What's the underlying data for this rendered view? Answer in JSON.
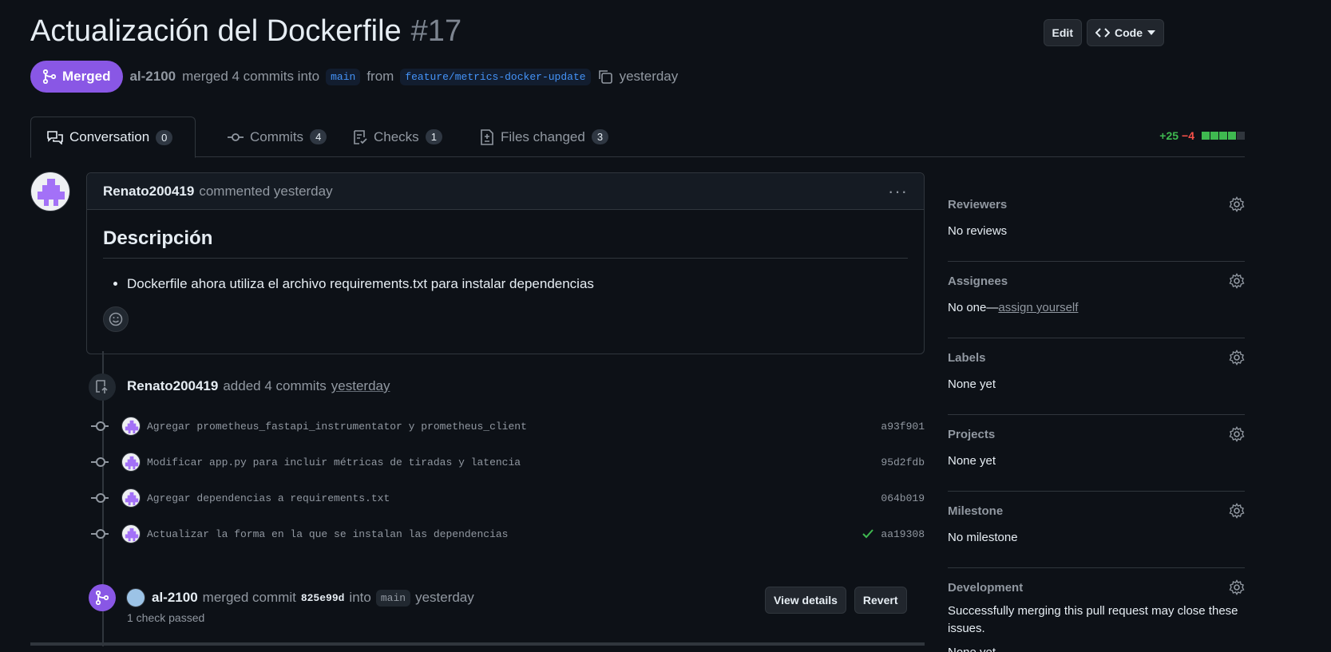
{
  "header": {
    "title": "Actualización del Dockerfile",
    "number": "#17",
    "edit_label": "Edit",
    "code_label": "Code"
  },
  "meta": {
    "state": "Merged",
    "author": "al-2100",
    "text_merged": "merged 4 commits into",
    "base_branch": "main",
    "text_from": "from",
    "head_branch": "feature/metrics-docker-update",
    "time": "yesterday"
  },
  "tabs": [
    {
      "label": "Conversation",
      "count": "0"
    },
    {
      "label": "Commits",
      "count": "4"
    },
    {
      "label": "Checks",
      "count": "1"
    },
    {
      "label": "Files changed",
      "count": "3"
    }
  ],
  "diffstat": {
    "additions": "+25",
    "deletions": "−4",
    "colors": [
      "#3fb950",
      "#3fb950",
      "#3fb950",
      "#3fb950",
      "#30363d"
    ]
  },
  "comment": {
    "author": "Renato200419",
    "action": "commented yesterday",
    "heading": "Descripción",
    "bullets": [
      "Dockerfile ahora utiliza el archivo requirements.txt para instalar dependencias"
    ]
  },
  "commits_event": {
    "author": "Renato200419",
    "action": "added 4 commits",
    "time": "yesterday"
  },
  "commits": [
    {
      "message": "Agregar prometheus_fastapi_instrumentator y prometheus_client",
      "sha": "a93f901",
      "check": false
    },
    {
      "message": "Modificar app.py para incluir métricas de tiradas y latencia",
      "sha": "95d2fdb",
      "check": false
    },
    {
      "message": "Agregar dependencias a requirements.txt",
      "sha": "064b019",
      "check": false
    },
    {
      "message": "Actualizar la forma en la que se instalan las dependencias",
      "sha": "aa19308",
      "check": true
    }
  ],
  "merge_event": {
    "author": "al-2100",
    "text": "merged commit",
    "sha": "825e99d",
    "into": "into",
    "branch": "main",
    "time": "yesterday",
    "checks": "1 check passed",
    "view_details": "View details",
    "revert": "Revert"
  },
  "sidebar": {
    "reviewers": {
      "title": "Reviewers",
      "value": "No reviews"
    },
    "assignees": {
      "title": "Assignees",
      "value": "No one—",
      "link": "assign yourself"
    },
    "labels": {
      "title": "Labels",
      "value": "None yet"
    },
    "projects": {
      "title": "Projects",
      "value": "None yet"
    },
    "milestone": {
      "title": "Milestone",
      "value": "No milestone"
    },
    "development": {
      "title": "Development",
      "value": "Successfully merging this pull request may close these issues.",
      "value2": "None yet"
    }
  }
}
